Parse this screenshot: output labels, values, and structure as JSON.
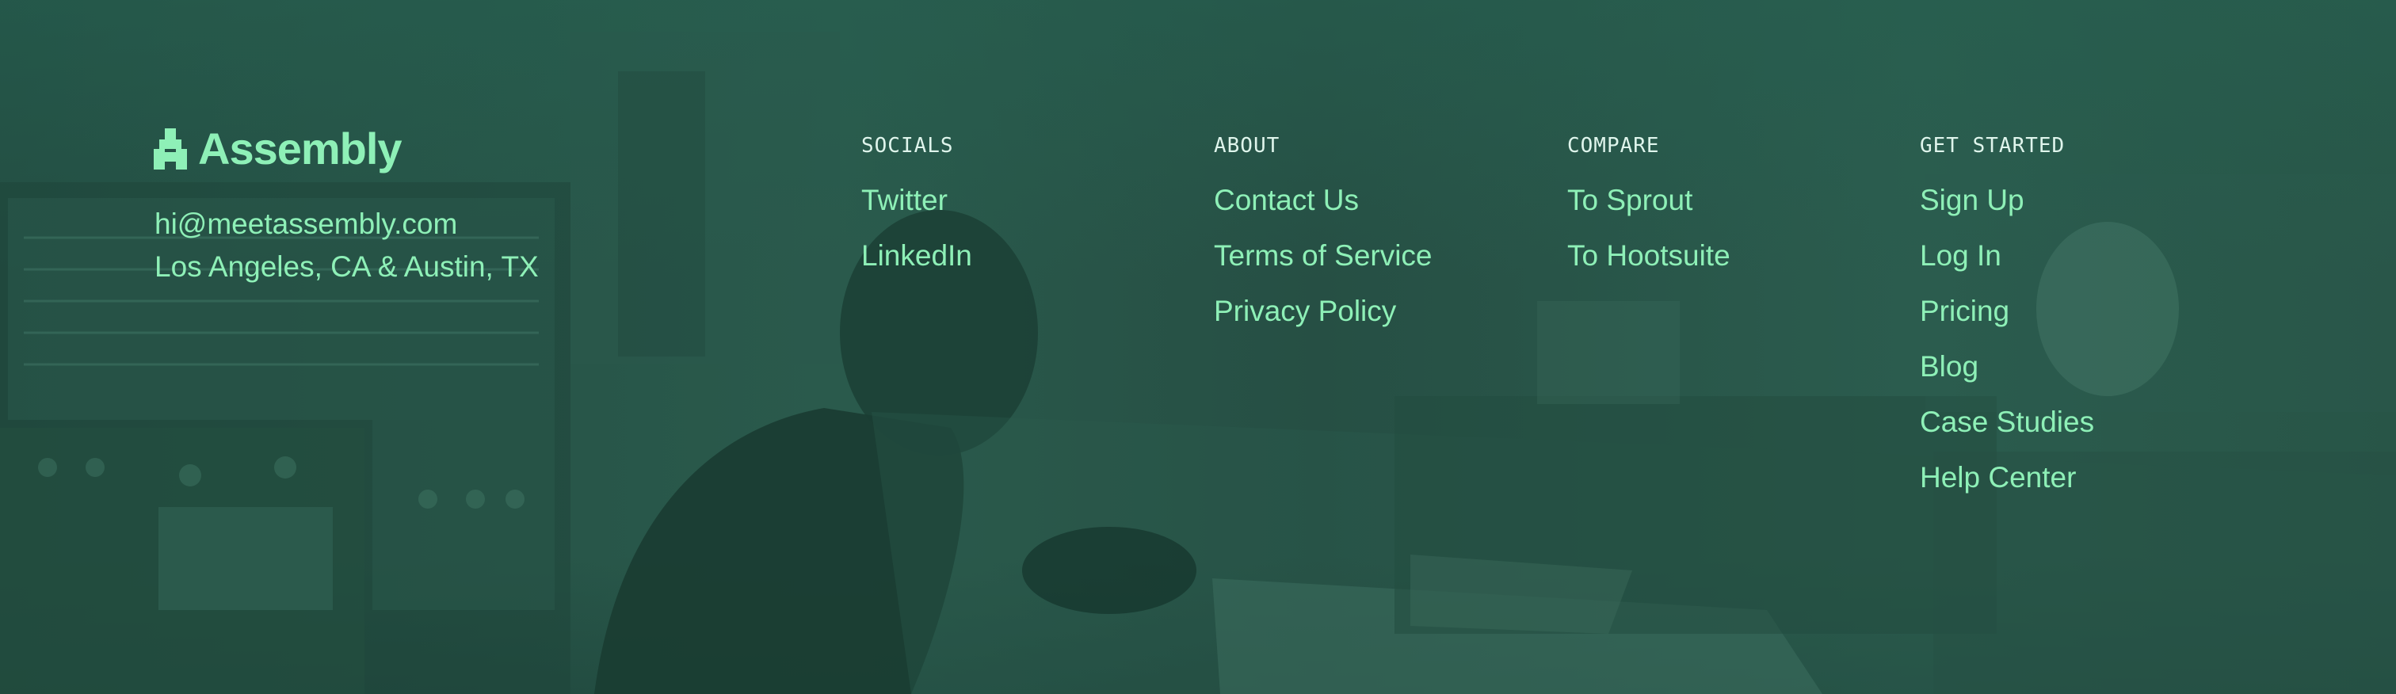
{
  "brand": {
    "name": "Assembly",
    "logo_icon": "assembly-logo-icon",
    "email": "hi@meetassembly.com",
    "location": "Los Angeles, CA & Austin, TX"
  },
  "columns": {
    "socials": {
      "heading": "SOCIALS",
      "links": [
        "Twitter",
        "LinkedIn"
      ]
    },
    "about": {
      "heading": "ABOUT",
      "links": [
        "Contact Us",
        "Terms of Service",
        "Privacy Policy"
      ]
    },
    "compare": {
      "heading": "COMPARE",
      "links": [
        "To Sprout",
        "To Hootsuite"
      ]
    },
    "get_started": {
      "heading": "GET STARTED",
      "links": [
        "Sign Up",
        "Log In",
        "Pricing",
        "Blog",
        "Case Studies",
        "Help Center"
      ]
    }
  },
  "colors": {
    "background": "#264f44",
    "accent": "#8ef0b7",
    "heading": "#dff5ec"
  }
}
